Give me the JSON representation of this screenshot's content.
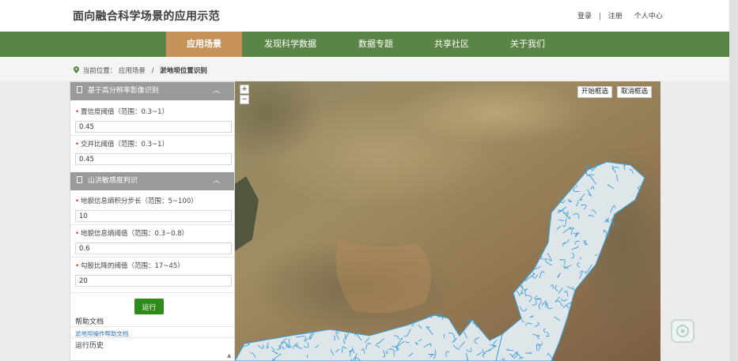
{
  "header": {
    "site_title": "面向融合科学场景的应用示范",
    "links": {
      "login": "登录",
      "separator": "|",
      "register": "注册",
      "profile": "个人中心"
    }
  },
  "nav": {
    "items": [
      {
        "label": "应用场景",
        "active": true
      },
      {
        "label": "发现科学数据",
        "active": false
      },
      {
        "label": "数据专题",
        "active": false
      },
      {
        "label": "共享社区",
        "active": false
      },
      {
        "label": "关于我们",
        "active": false
      }
    ]
  },
  "breadcrumb": {
    "prefix": "当前位置：",
    "level1": "应用场景",
    "slash": "/",
    "current": "淤地坝位置识别"
  },
  "sidebar": {
    "section1": {
      "title": "基于高分辨率影像识别",
      "fields": [
        {
          "label": "置信度阈值（范围：0.3~1）",
          "value": "0.45"
        },
        {
          "label": "交并比阈值（范围：0.3~1）",
          "value": "0.45"
        }
      ]
    },
    "section2": {
      "title": "山洪敏感度判识",
      "fields": [
        {
          "label": "地貌信息熵积分步长（范围：5~100）",
          "value": "10"
        },
        {
          "label": "地貌信息熵阈值（范围：0.3~0.8）",
          "value": "0.6"
        },
        {
          "label": "勾股比降的阈值（范围：17~45）",
          "value": "20"
        }
      ]
    },
    "run_label": "运行",
    "help_title": "帮助文档",
    "help_link": "淤地坝操作帮助文档",
    "history_title": "运行历史"
  },
  "map": {
    "zoom_in": "+",
    "zoom_out": "−",
    "start_select": "开始框选",
    "cancel_select": "取消框选",
    "watershed_fill": "#dfe6ea",
    "watershed_stroke": "#3b9fd6"
  },
  "colors": {
    "nav_bg": "#5b8547",
    "nav_active": "#c8935b",
    "run_button": "#2e8a19"
  }
}
